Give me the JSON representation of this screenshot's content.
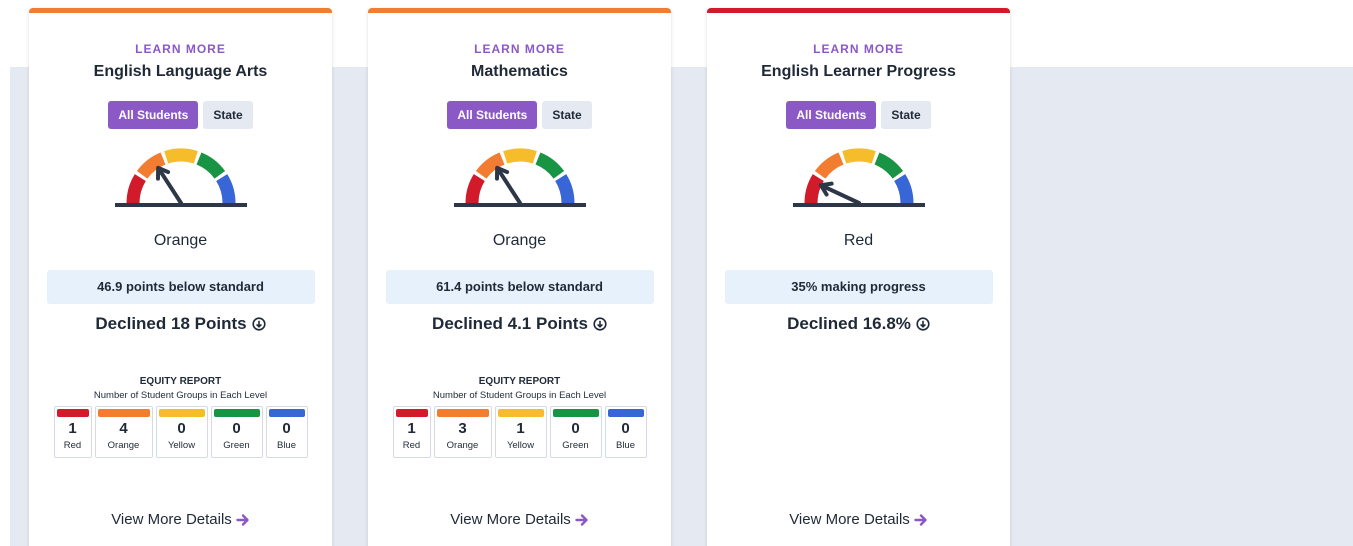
{
  "colors": {
    "red": "#d11a2a",
    "orange": "#f27c2f",
    "yellow": "#f5bd29",
    "green": "#199444",
    "blue": "#3966d6",
    "purple": "#8b59c6",
    "needle": "#2d3748"
  },
  "cards": [
    {
      "learn_more": "LEARN MORE",
      "title": "English Language Arts",
      "topbar_color": "#f27c2f",
      "toggle": {
        "active": "All Students",
        "inactive": "State"
      },
      "gauge": {
        "level": "orange",
        "needle_angle_deg": 123
      },
      "color_label": "Orange",
      "status": "46.9 points below standard",
      "change": "Declined 18 Points",
      "equity": {
        "title": "EQUITY REPORT",
        "subtitle": "Number of Student Groups in Each Level",
        "levels": [
          {
            "count": "1",
            "name": "Red",
            "color": "#d11a2a"
          },
          {
            "count": "4",
            "name": "Orange",
            "color": "#f27c2f"
          },
          {
            "count": "0",
            "name": "Yellow",
            "color": "#f5bd29"
          },
          {
            "count": "0",
            "name": "Green",
            "color": "#199444"
          },
          {
            "count": "0",
            "name": "Blue",
            "color": "#3966d6"
          }
        ]
      },
      "view_more": "View More Details"
    },
    {
      "learn_more": "LEARN MORE",
      "title": "Mathematics",
      "topbar_color": "#f27c2f",
      "toggle": {
        "active": "All Students",
        "inactive": "State"
      },
      "gauge": {
        "level": "orange",
        "needle_angle_deg": 123
      },
      "color_label": "Orange",
      "status": "61.4 points below standard",
      "change": "Declined 4.1 Points",
      "equity": {
        "title": "EQUITY REPORT",
        "subtitle": "Number of Student Groups in Each Level",
        "levels": [
          {
            "count": "1",
            "name": "Red",
            "color": "#d11a2a"
          },
          {
            "count": "3",
            "name": "Orange",
            "color": "#f27c2f"
          },
          {
            "count": "1",
            "name": "Yellow",
            "color": "#f5bd29"
          },
          {
            "count": "0",
            "name": "Green",
            "color": "#199444"
          },
          {
            "count": "0",
            "name": "Blue",
            "color": "#3966d6"
          }
        ]
      },
      "view_more": "View More Details"
    },
    {
      "learn_more": "LEARN MORE",
      "title": "English Learner Progress",
      "topbar_color": "#d11a2a",
      "toggle": {
        "active": "All Students",
        "inactive": "State"
      },
      "gauge": {
        "level": "red",
        "needle_angle_deg": 155
      },
      "color_label": "Red",
      "status": "35% making progress",
      "change": "Declined 16.8%",
      "equity": null,
      "view_more": "View More Details"
    }
  ]
}
